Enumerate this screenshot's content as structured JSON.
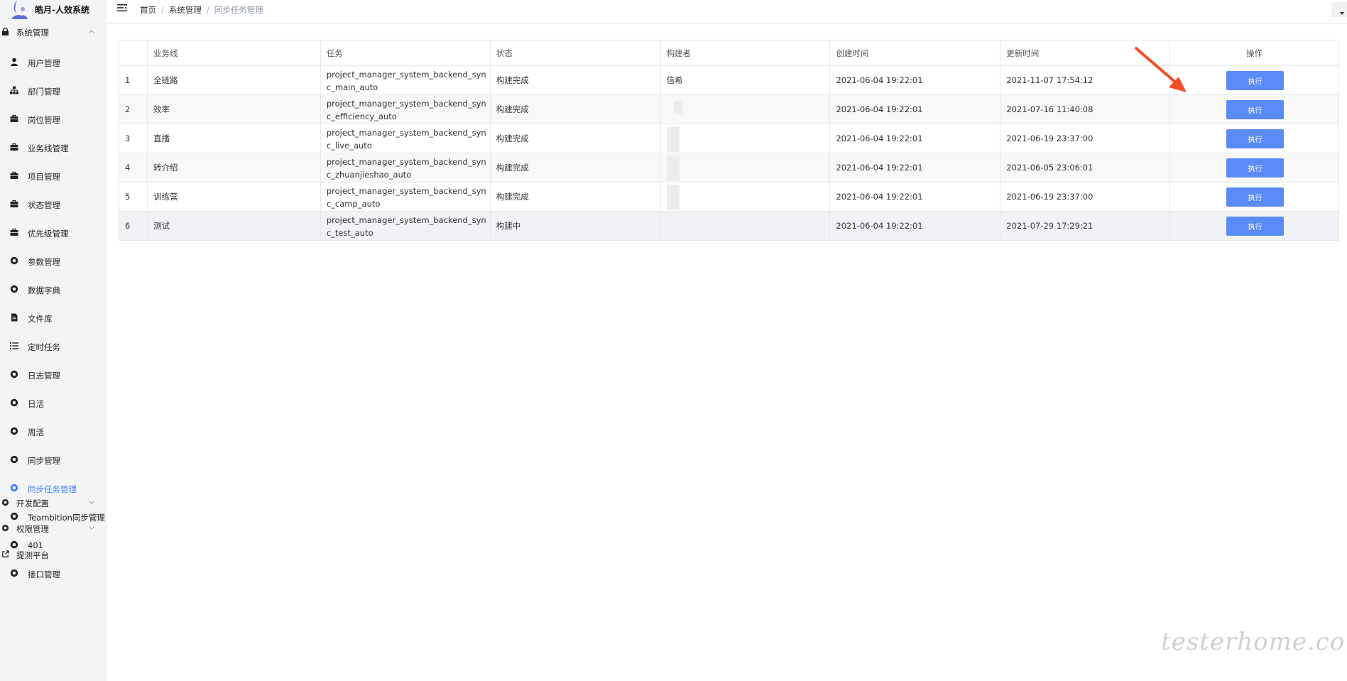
{
  "app": {
    "title": "皓月-人效系统"
  },
  "sidebar": {
    "system_group": {
      "label": "系统管理",
      "icon": "lock-icon"
    },
    "items": [
      {
        "label": "用户管理",
        "icon": "user-icon"
      },
      {
        "label": "部门管理",
        "icon": "org-tree-icon"
      },
      {
        "label": "岗位管理",
        "icon": "briefcase-icon"
      },
      {
        "label": "业务线管理",
        "icon": "briefcase-icon"
      },
      {
        "label": "项目管理",
        "icon": "briefcase-icon"
      },
      {
        "label": "状态管理",
        "icon": "briefcase-icon"
      },
      {
        "label": "优先级管理",
        "icon": "briefcase-icon"
      },
      {
        "label": "参数管理",
        "icon": "gear-icon"
      },
      {
        "label": "数据字典",
        "icon": "gear-icon"
      },
      {
        "label": "文件库",
        "icon": "document-icon"
      },
      {
        "label": "定时任务",
        "icon": "list-icon"
      },
      {
        "label": "日志管理",
        "icon": "gear-icon"
      },
      {
        "label": "日活",
        "icon": "gear-icon"
      },
      {
        "label": "周活",
        "icon": "gear-icon"
      },
      {
        "label": "同步管理",
        "icon": "gear-icon"
      },
      {
        "label": "同步任务管理",
        "icon": "gear-icon",
        "active": true
      },
      {
        "label": "Teambition同步管理",
        "icon": "gear-icon"
      },
      {
        "label": "401",
        "icon": "gear-icon"
      },
      {
        "label": "接口管理",
        "icon": "gear-icon"
      }
    ],
    "dev_group": {
      "label": "开发配置",
      "icon": "gear-icon"
    },
    "perm_group": {
      "label": "权限管理",
      "icon": "gear-icon"
    },
    "test_platform": {
      "label": "提测平台",
      "icon": "external-link-icon"
    }
  },
  "header": {
    "breadcrumb": [
      "首页",
      "系统管理",
      "同步任务管理"
    ]
  },
  "table": {
    "columns": [
      "",
      "业务线",
      "任务",
      "状态",
      "构建者",
      "创建时间",
      "更新时间",
      "操作"
    ],
    "rows": [
      {
        "index": "1",
        "line": "全链路",
        "task": "project_manager_system_backend_sync_main_auto",
        "status": "构建完成",
        "builder": "信希",
        "created": "2021-06-04 19:22:01",
        "updated": "2021-11-07 17:54:12",
        "action": "执行"
      },
      {
        "index": "2",
        "line": "效率",
        "task": "project_manager_system_backend_sync_efficiency_auto",
        "status": "构建完成",
        "builder": "",
        "created": "2021-06-04 19:22:01",
        "updated": "2021-07-16 11:40:08",
        "action": "执行"
      },
      {
        "index": "3",
        "line": "直播",
        "task": "project_manager_system_backend_sync_live_auto",
        "status": "构建完成",
        "builder": "",
        "created": "2021-06-04 19:22:01",
        "updated": "2021-06-19 23:37:00",
        "action": "执行"
      },
      {
        "index": "4",
        "line": "转介绍",
        "task": "project_manager_system_backend_sync_zhuanjieshao_auto",
        "status": "构建完成",
        "builder": "",
        "created": "2021-06-04 19:22:01",
        "updated": "2021-06-05 23:06:01",
        "action": "执行"
      },
      {
        "index": "5",
        "line": "训练营",
        "task": "project_manager_system_backend_sync_camp_auto",
        "status": "构建完成",
        "builder": "",
        "created": "2021-06-04 19:22:01",
        "updated": "2021-06-19 23:37:00",
        "action": "执行"
      },
      {
        "index": "6",
        "line": "测试",
        "task": "project_manager_system_backend_sync_test_auto",
        "status": "构建中",
        "builder": "",
        "created": "2021-06-04 19:22:01",
        "updated": "2021-07-29 17:29:21",
        "action": "执行"
      }
    ]
  },
  "colors": {
    "accent": "#3f83f8",
    "button": "#5b8bf7",
    "arrow": "#f24e2a"
  },
  "watermark": "testerhome.com"
}
